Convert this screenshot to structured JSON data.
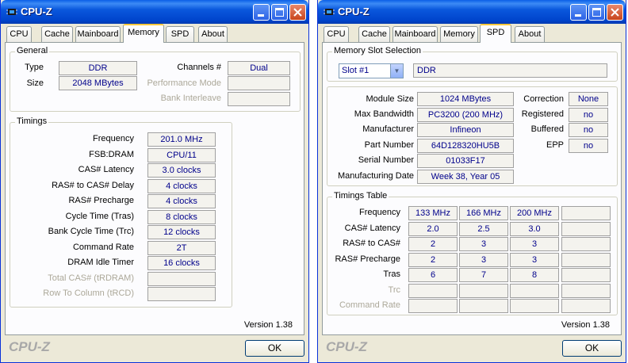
{
  "left_window": {
    "title": "CPU-Z",
    "tabs": [
      {
        "label": "CPU"
      },
      {
        "label": "Cache"
      },
      {
        "label": "Mainboard"
      },
      {
        "label": "Memory"
      },
      {
        "label": "SPD"
      },
      {
        "label": "About"
      }
    ],
    "active_tab": "Memory",
    "general": {
      "title": "General",
      "type_label": "Type",
      "type_value": "DDR",
      "size_label": "Size",
      "size_value": "2048 MBytes",
      "channels_label": "Channels #",
      "channels_value": "Dual",
      "perf_mode_label": "Performance Mode",
      "perf_mode_value": "",
      "bank_interleave_label": "Bank Interleave",
      "bank_interleave_value": ""
    },
    "timings": {
      "title": "Timings",
      "rows": [
        {
          "label": "Frequency",
          "value": "201.0 MHz",
          "enabled": true
        },
        {
          "label": "FSB:DRAM",
          "value": "CPU/11",
          "enabled": true
        },
        {
          "label": "CAS# Latency",
          "value": "3.0 clocks",
          "enabled": true
        },
        {
          "label": "RAS# to CAS# Delay",
          "value": "4 clocks",
          "enabled": true
        },
        {
          "label": "RAS# Precharge",
          "value": "4 clocks",
          "enabled": true
        },
        {
          "label": "Cycle Time (Tras)",
          "value": "8 clocks",
          "enabled": true
        },
        {
          "label": "Bank Cycle Time (Trc)",
          "value": "12 clocks",
          "enabled": true
        },
        {
          "label": "Command Rate",
          "value": "2T",
          "enabled": true
        },
        {
          "label": "DRAM Idle Timer",
          "value": "16 clocks",
          "enabled": true
        },
        {
          "label": "Total CAS# (tRDRAM)",
          "value": "",
          "enabled": false
        },
        {
          "label": "Row To Column (tRCD)",
          "value": "",
          "enabled": false
        }
      ]
    },
    "version": "Version 1.38",
    "brand": "CPU-Z",
    "ok_label": "OK"
  },
  "right_window": {
    "title": "CPU-Z",
    "tabs": [
      {
        "label": "CPU"
      },
      {
        "label": "Cache"
      },
      {
        "label": "Mainboard"
      },
      {
        "label": "Memory"
      },
      {
        "label": "SPD"
      },
      {
        "label": "About"
      }
    ],
    "active_tab": "SPD",
    "slot_selection": {
      "title": "Memory Slot Selection",
      "selected_slot": "Slot #1",
      "type_value": "DDR"
    },
    "module": {
      "module_size_label": "Module Size",
      "module_size_value": "1024 MBytes",
      "max_bandwidth_label": "Max Bandwidth",
      "max_bandwidth_value": "PC3200 (200 MHz)",
      "manufacturer_label": "Manufacturer",
      "manufacturer_value": "Infineon",
      "part_number_label": "Part Number",
      "part_number_value": "64D128320HU5B",
      "serial_number_label": "Serial Number",
      "serial_number_value": "01033F17",
      "mfg_date_label": "Manufacturing Date",
      "mfg_date_value": "Week 38, Year 05",
      "correction_label": "Correction",
      "correction_value": "None",
      "registered_label": "Registered",
      "registered_value": "no",
      "buffered_label": "Buffered",
      "buffered_value": "no",
      "epp_label": "EPP",
      "epp_value": "no"
    },
    "timings_table": {
      "title": "Timings Table",
      "rows": [
        {
          "label": "Frequency",
          "cells": [
            "133 MHz",
            "166 MHz",
            "200 MHz",
            ""
          ],
          "enabled": true
        },
        {
          "label": "CAS# Latency",
          "cells": [
            "2.0",
            "2.5",
            "3.0",
            ""
          ],
          "enabled": true
        },
        {
          "label": "RAS# to CAS#",
          "cells": [
            "2",
            "3",
            "3",
            ""
          ],
          "enabled": true
        },
        {
          "label": "RAS# Precharge",
          "cells": [
            "2",
            "3",
            "3",
            ""
          ],
          "enabled": true
        },
        {
          "label": "Tras",
          "cells": [
            "6",
            "7",
            "8",
            ""
          ],
          "enabled": true
        },
        {
          "label": "Trc",
          "cells": [
            "",
            "",
            "",
            ""
          ],
          "enabled": false
        },
        {
          "label": "Command Rate",
          "cells": [
            "",
            "",
            "",
            ""
          ],
          "enabled": false
        }
      ]
    },
    "version": "Version 1.38",
    "brand": "CPU-Z",
    "ok_label": "OK"
  },
  "colors": {
    "titlebar": "#0a58dd",
    "window_bg": "#ece9d8",
    "value_text": "#00008b",
    "disabled_text": "#aca899",
    "active_tab_accent": "#ffc83c",
    "close_button": "#c8451c"
  }
}
